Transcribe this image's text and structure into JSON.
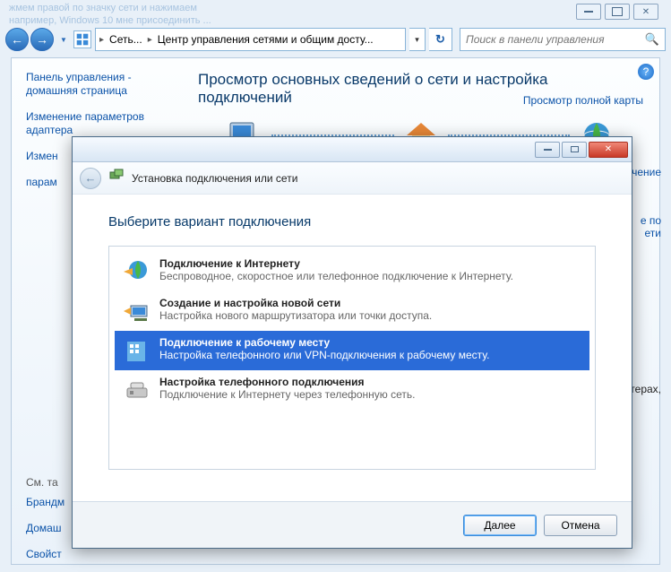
{
  "top_ghost": {
    "l1": "жмем правой по значку сети и нажимаем",
    "l2": "например, Windows 10 мне присоединить ..."
  },
  "nav": {
    "seg1": "Сеть...",
    "seg2": "Центр управления сетями и общим досту...",
    "search_placeholder": "Поиск в панели управления"
  },
  "sidebar": {
    "home": "Панель управления - домашняя страница",
    "adapter": "Изменение параметров адаптера",
    "sharing_trunc": "Измен",
    "param_trunc": "парам",
    "seealso": "См. та",
    "firewall": "Брандм",
    "homegroup": "Домаш",
    "internet": "Свойст"
  },
  "content": {
    "title": "Просмотр основных сведений о сети и настройка подключений",
    "viewmap": "Просмотр полной карты",
    "node_pc": "Компьютер",
    "node_net": "Сеть",
    "node_inet": "Интернет",
    "ghost_link1": "чение",
    "ghost_link2": "е по",
    "ghost_link3": "ети",
    "ghost_txt": "терах,"
  },
  "wizard": {
    "header": "Установка подключения или сети",
    "heading": "Выберите вариант подключения",
    "options": [
      {
        "title": "Подключение к Интернету",
        "desc": "Беспроводное, скоростное или телефонное подключение к Интернету."
      },
      {
        "title": "Создание и настройка новой сети",
        "desc": "Настройка нового маршрутизатора или точки доступа."
      },
      {
        "title": "Подключение к рабочему месту",
        "desc": "Настройка телефонного или VPN-подключения к рабочему месту."
      },
      {
        "title": "Настройка телефонного подключения",
        "desc": "Подключение к Интернету через телефонную сеть."
      }
    ],
    "next": "Далее",
    "cancel": "Отмена"
  }
}
